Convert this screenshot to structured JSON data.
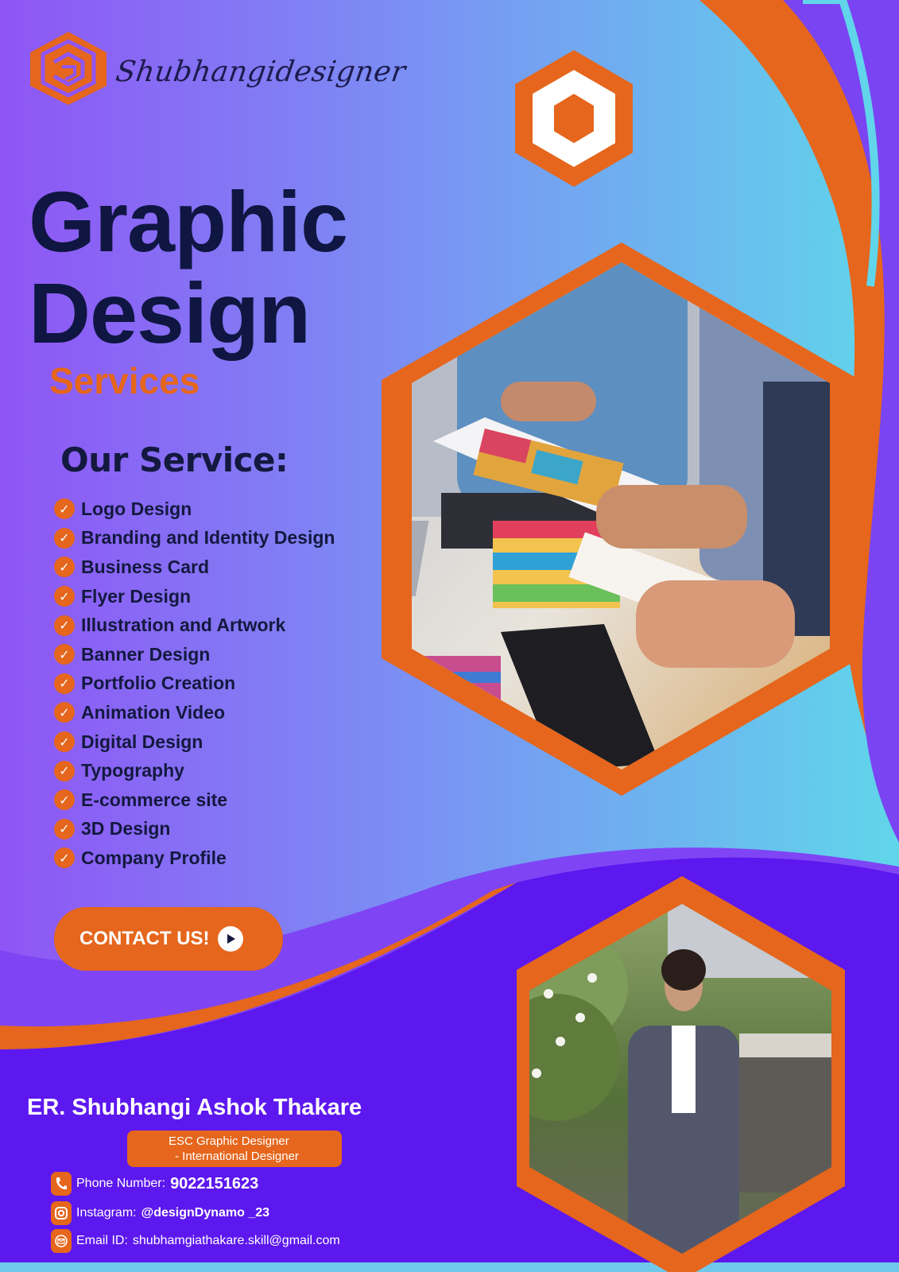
{
  "brand": {
    "name": "Shubhangidesigner",
    "logo_icon": "brand-monogram-icon"
  },
  "hero": {
    "line1": "Graphic",
    "line2": "Design",
    "line3": "Services"
  },
  "services": {
    "heading": "Our Service:",
    "items": [
      "Logo Design",
      "Branding and Identity Design",
      "Business Card",
      "Flyer Design",
      "Illustration and Artwork",
      "Banner Design",
      "Portfolio Creation",
      "Animation Video",
      "Digital Design",
      "Typography",
      "E-commerce site",
      "3D Design",
      "Company Profile"
    ],
    "check_icon": "check-circle-icon"
  },
  "cta": {
    "label": "CONTACT US!",
    "icon": "play-arrow-icon"
  },
  "profile": {
    "name": "ER. Shubhangi Ashok Thakare",
    "role_line1": "ESC Graphic Designer",
    "role_line2": "- International Designer"
  },
  "contact": {
    "phone_label": "Phone Number:",
    "phone_value": "9022151623",
    "instagram_label": "Instagram:",
    "instagram_value": "@designDynamo _23",
    "email_label": "Email ID:",
    "email_value": "shubhamgiathakare.skill@gmail.com"
  },
  "colors": {
    "orange": "#e5661c",
    "navy": "#13193f",
    "deep_purple": "#5c18ee",
    "gradient_left": "#8f55f5",
    "gradient_right": "#60d6ea"
  }
}
